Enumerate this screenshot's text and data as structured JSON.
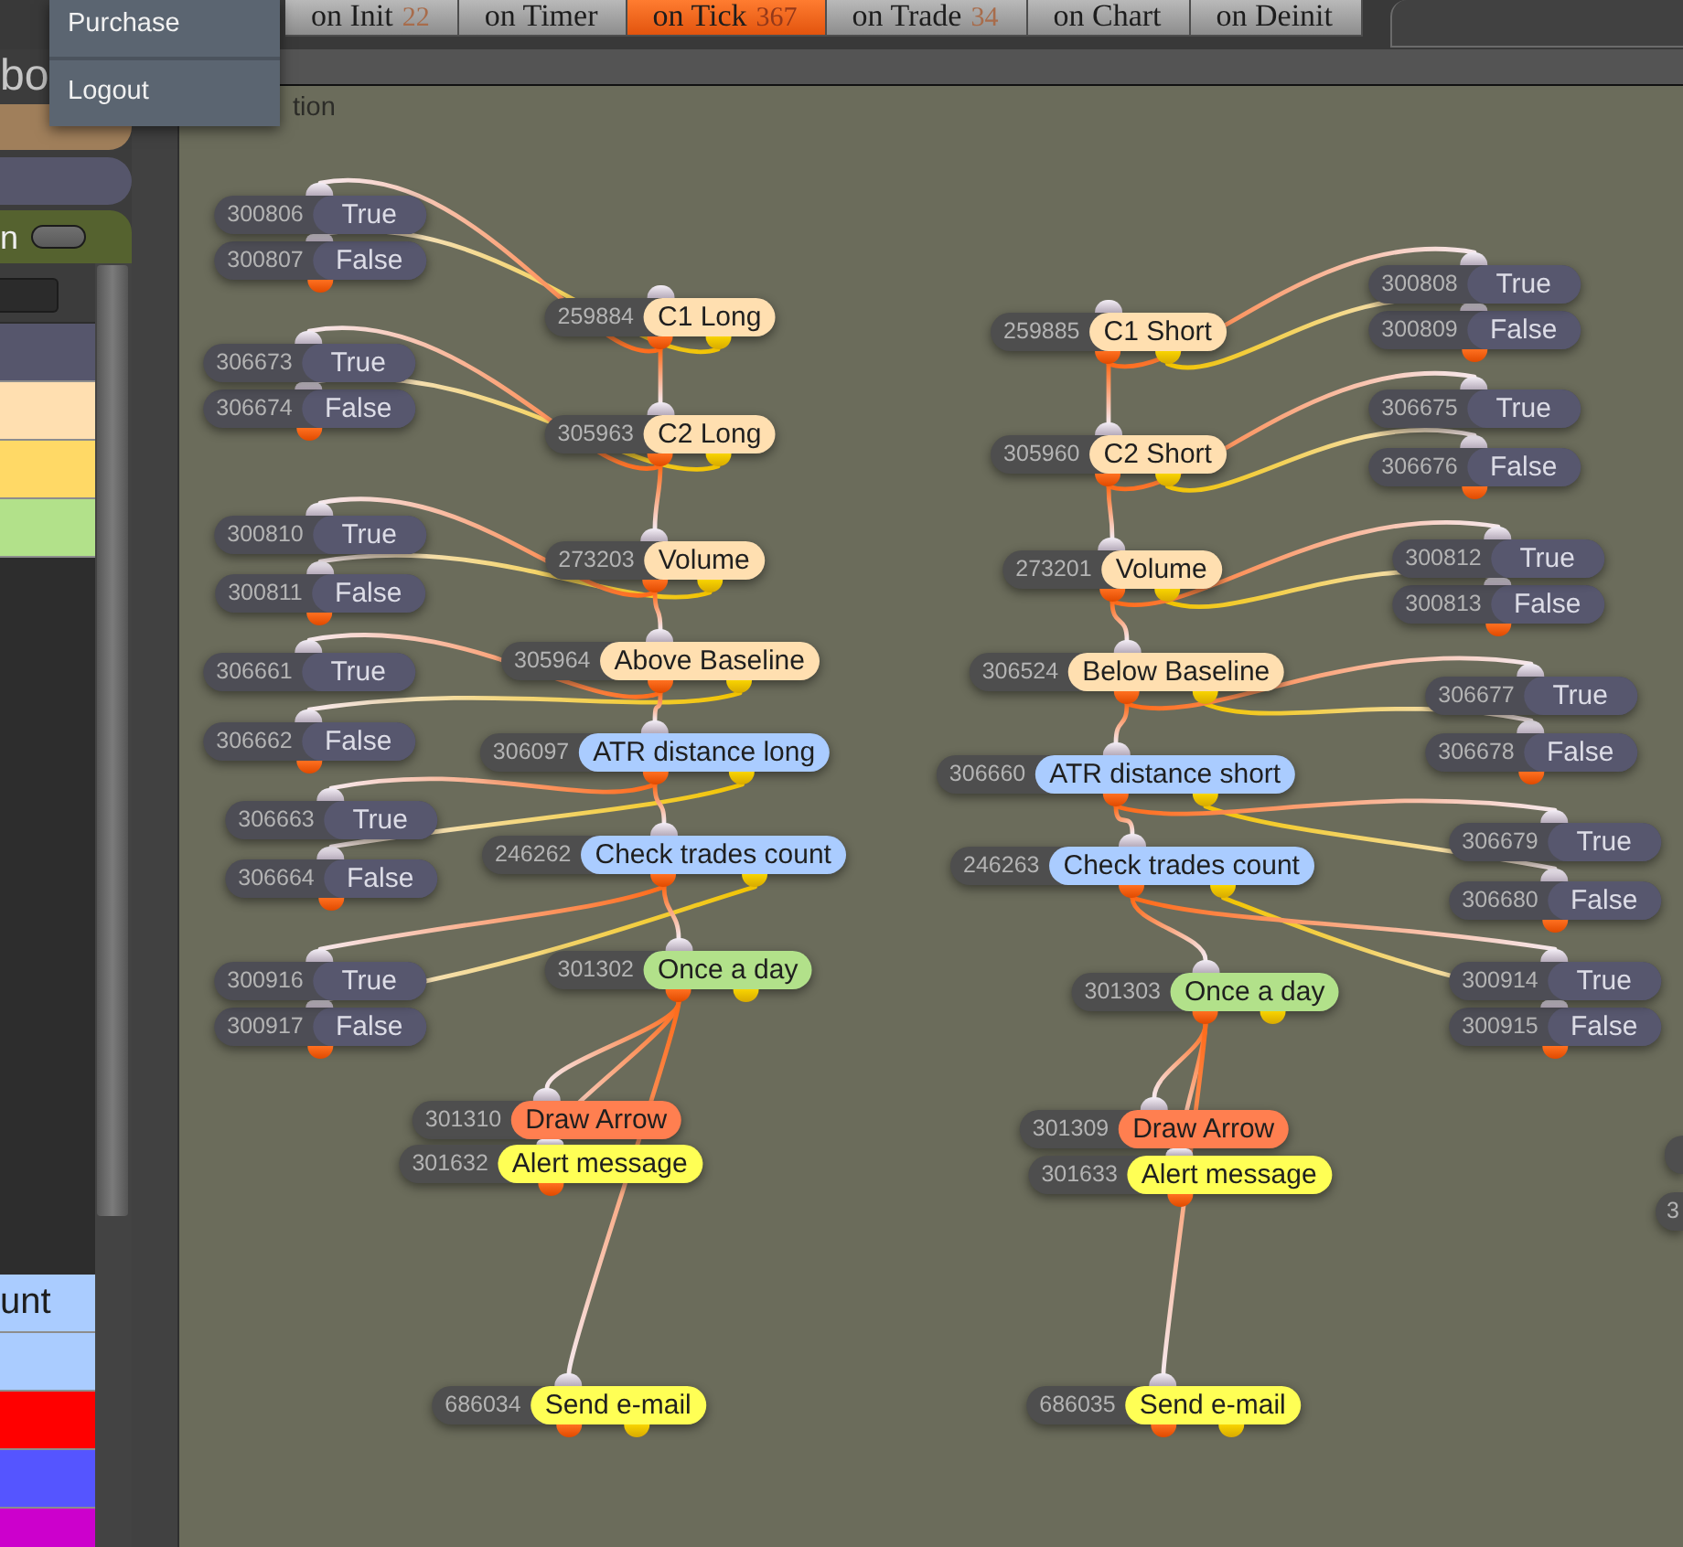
{
  "menu": {
    "items": [
      {
        "label": "Purchase"
      },
      {
        "label": "Logout"
      }
    ]
  },
  "tabs": [
    {
      "label": "on Init",
      "count": "22",
      "selected": false
    },
    {
      "label": "on Timer",
      "selected": false
    },
    {
      "label": "on Tick",
      "count": "367",
      "selected": true
    },
    {
      "label": "on Trade",
      "count": "34",
      "selected": false
    },
    {
      "label": "on Chart",
      "selected": false
    },
    {
      "label": "on Deinit",
      "selected": false
    }
  ],
  "sidebar": {
    "title": "bo",
    "section": {
      "label": "n",
      "toggle": {
        "on": false
      }
    },
    "rows": [
      {
        "color": "#56566c"
      },
      {
        "color": "#ffdfb0"
      },
      {
        "color": "#ffd966"
      },
      {
        "color": "#b2e18a"
      }
    ],
    "rows_lower": [
      {
        "color": "#aaccff",
        "label": "unt"
      },
      {
        "color": "#aaccff"
      },
      {
        "color": "#ff0000"
      },
      {
        "color": "#5555ff"
      },
      {
        "color": "#cc00cc"
      }
    ]
  },
  "canvas": {
    "label": "tion",
    "flows": [
      {
        "steps": [
          {
            "id": "259884",
            "label": "C1 Long",
            "color": "#ffdfb0",
            "branches": [
              {
                "id": "300806",
                "label": "True"
              },
              {
                "id": "300807",
                "label": "False"
              }
            ]
          },
          {
            "id": "305963",
            "label": "C2 Long",
            "color": "#ffdfb0",
            "branches": [
              {
                "id": "306673",
                "label": "True"
              },
              {
                "id": "306674",
                "label": "False"
              }
            ]
          },
          {
            "id": "273203",
            "label": "Volume",
            "color": "#ffdfb0",
            "branches": [
              {
                "id": "300810",
                "label": "True"
              },
              {
                "id": "300811",
                "label": "False"
              }
            ]
          },
          {
            "id": "305964",
            "label": "Above Baseline",
            "color": "#ffdfb0",
            "branches": [
              {
                "id": "306661",
                "label": "True"
              },
              {
                "id": "306662",
                "label": "False"
              }
            ]
          },
          {
            "id": "306097",
            "label": "ATR distance long",
            "color": "#aaccff",
            "branches": [
              {
                "id": "306663",
                "label": "True"
              },
              {
                "id": "306664",
                "label": "False"
              }
            ]
          },
          {
            "id": "246262",
            "label": "Check trades count",
            "color": "#aaccff",
            "branches": [
              {
                "id": "300916",
                "label": "True"
              },
              {
                "id": "300917",
                "label": "False"
              }
            ]
          },
          {
            "id": "301302",
            "label": "Once a day",
            "color": "#b2e18a"
          }
        ],
        "actions": [
          {
            "id": "301310",
            "label": "Draw Arrow",
            "color": "#ff7f50"
          },
          {
            "id": "301632",
            "label": "Alert message",
            "color": "#ffff55"
          },
          {
            "id": "686034",
            "label": "Send e-mail",
            "color": "#ffff55"
          }
        ]
      },
      {
        "steps": [
          {
            "id": "259885",
            "label": "C1 Short",
            "color": "#ffdfb0",
            "branches": [
              {
                "id": "300808",
                "label": "True"
              },
              {
                "id": "300809",
                "label": "False"
              }
            ]
          },
          {
            "id": "305960",
            "label": "C2 Short",
            "color": "#ffdfb0",
            "branches": [
              {
                "id": "306675",
                "label": "True"
              },
              {
                "id": "306676",
                "label": "False"
              }
            ]
          },
          {
            "id": "273201",
            "label": "Volume",
            "color": "#ffdfb0",
            "branches": [
              {
                "id": "300812",
                "label": "True"
              },
              {
                "id": "300813",
                "label": "False"
              }
            ]
          },
          {
            "id": "306524",
            "label": "Below Baseline",
            "color": "#ffdfb0",
            "branches": [
              {
                "id": "306677",
                "label": "True"
              },
              {
                "id": "306678",
                "label": "False"
              }
            ]
          },
          {
            "id": "306660",
            "label": "ATR distance short",
            "color": "#aaccff",
            "branches": [
              {
                "id": "306679",
                "label": "True"
              },
              {
                "id": "306680",
                "label": "False"
              }
            ]
          },
          {
            "id": "246263",
            "label": "Check trades count",
            "color": "#aaccff",
            "branches": [
              {
                "id": "300914",
                "label": "True"
              },
              {
                "id": "300915",
                "label": "False"
              }
            ]
          },
          {
            "id": "301303",
            "label": "Once a day",
            "color": "#b2e18a"
          }
        ],
        "actions": [
          {
            "id": "301309",
            "label": "Draw Arrow",
            "color": "#ff7f50"
          },
          {
            "id": "301633",
            "label": "Alert message",
            "color": "#ffff55"
          },
          {
            "id": "686035",
            "label": "Send e-mail",
            "color": "#ffff55"
          }
        ]
      }
    ],
    "edge_nodes": [
      {
        "id": "3"
      }
    ]
  }
}
